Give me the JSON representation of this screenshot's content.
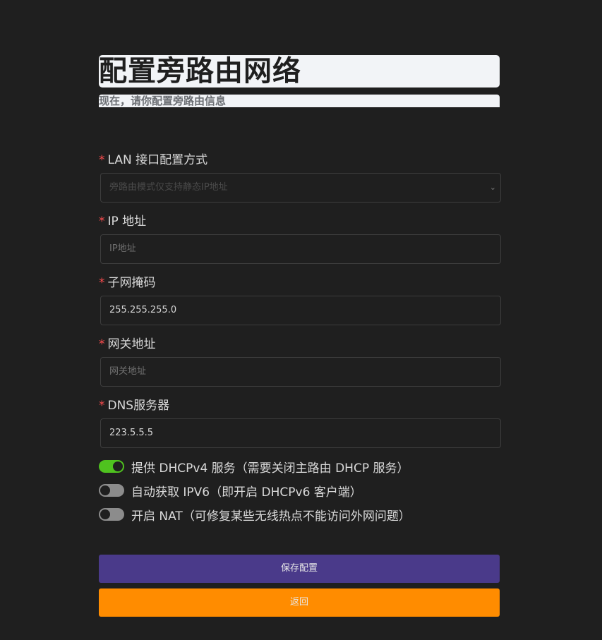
{
  "header": {
    "title": "配置旁路由网络",
    "subtitle": "现在，请你配置旁路由信息"
  },
  "form": {
    "required_mark": "*",
    "lan_mode": {
      "label": "LAN 接口配置方式",
      "value": "旁路由模式仅支持静态IP地址"
    },
    "ip_address": {
      "label": "IP 地址",
      "placeholder": "IP地址",
      "value": ""
    },
    "subnet_mask": {
      "label": "子网掩码",
      "value": "255.255.255.0"
    },
    "gateway": {
      "label": "网关地址",
      "placeholder": "网关地址",
      "value": ""
    },
    "dns": {
      "label": "DNS服务器",
      "value": "223.5.5.5"
    }
  },
  "toggles": [
    {
      "label": "提供 DHCPv4 服务（需要关闭主路由 DHCP 服务）",
      "on": true
    },
    {
      "label": "自动获取 IPV6（即开启 DHCPv6 客户端）",
      "on": false
    },
    {
      "label": "开启 NAT（可修复某些无线热点不能访问外网问题）",
      "on": false
    }
  ],
  "actions": {
    "save_label": "保存配置",
    "back_label": "返回"
  },
  "colors": {
    "background": "#1f1f1f",
    "save_button": "#4a3a8a",
    "back_button": "#ff8c00",
    "toggle_on": "#4fc21f",
    "required": "#ff4d4f"
  }
}
